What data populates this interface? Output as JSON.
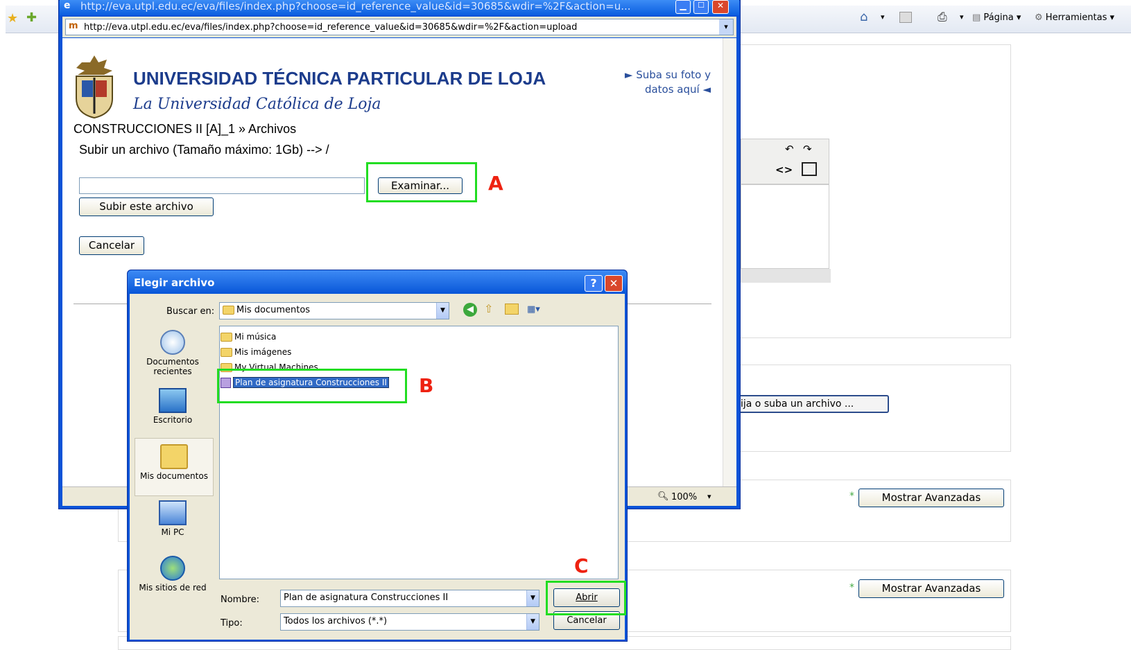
{
  "ie_toolbar": {
    "home_arrow": "▾",
    "page_label": "Página",
    "tools_label": "Herramientas"
  },
  "popup": {
    "title_url": "http://eva.utpl.edu.ec/eva/files/index.php?choose=id_reference_value&id=30685&wdir=%2F&action=u...",
    "address": "http://eva.utpl.edu.ec/eva/files/index.php?choose=id_reference_value&id=30685&wdir=%2F&action=upload",
    "university_name": "UNIVERSIDAD TÉCNICA PARTICULAR DE LOJA",
    "university_subtitle": "La Universidad Católica de Loja",
    "photo_link_line1": "► Suba su foto y",
    "photo_link_line2": "datos aquí ◄",
    "breadcrumb": "CONSTRUCCIONES II [A]_1 » Archivos",
    "upload_heading": "Subir un archivo (Tamaño máximo: 1Gb) --> /",
    "browse_button": "Examinar...",
    "upload_button": "Subir este archivo",
    "cancel_button": "Cancelar",
    "zoom": "100%"
  },
  "background": {
    "choose_file_button": "ija o suba un archivo ...",
    "advanced_button_1": "Mostrar Avanzadas",
    "advanced_button_2": "Mostrar Avanzadas",
    "asterisk": "*"
  },
  "dialog": {
    "title": "Elegir archivo",
    "help_glyph": "?",
    "close_glyph": "✕",
    "look_in_label": "Buscar en:",
    "look_in_value": "Mis documentos",
    "places": [
      {
        "label": "Documentos recientes"
      },
      {
        "label": "Escritorio"
      },
      {
        "label": "Mis documentos"
      },
      {
        "label": "Mi PC"
      },
      {
        "label": "Mis sitios de red"
      }
    ],
    "files": [
      {
        "name": "Mi música"
      },
      {
        "name": "Mis imágenes"
      },
      {
        "name": "My Virtual Machines"
      },
      {
        "name": "Plan de asignatura Construcciones II"
      }
    ],
    "filename_label": "Nombre:",
    "filename_value": "Plan de asignatura Construcciones II",
    "filetype_label": "Tipo:",
    "filetype_value": "Todos los archivos (*.*)",
    "open_button": "Abrir",
    "cancel_button": "Cancelar"
  },
  "annotations": {
    "a": "A",
    "b": "B",
    "c": "C",
    "highlight_color": "#22dd22",
    "letter_color": "#ee2211"
  }
}
